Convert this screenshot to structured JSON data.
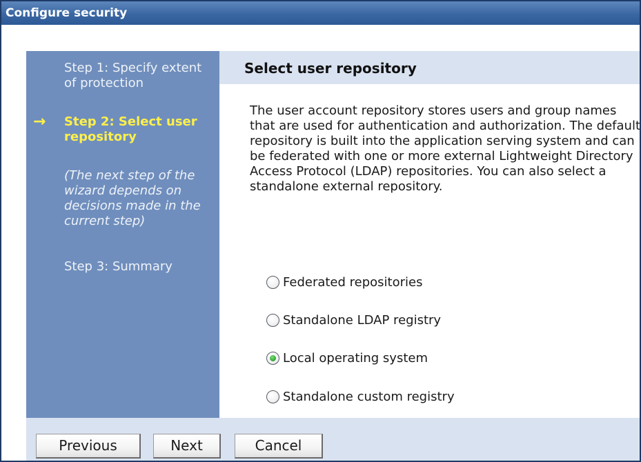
{
  "window": {
    "title": "Configure security"
  },
  "nav": {
    "step1": "Step 1: Specify extent of protection",
    "step2": "Step 2: Select user repository",
    "current_marker": "→",
    "note": "(The next step of the wizard depends on decisions made in the current step)",
    "step3": "Step 3: Summary"
  },
  "content": {
    "title": "Select user repository",
    "description": "The user account repository stores users and group names that are used for authentication and authorization. The default repository is built into the application serving system and can be federated with one or more external Lightweight Directory Access Protocol (LDAP) repositories. You can also select a standalone external repository.",
    "options": [
      {
        "label": "Federated repositories",
        "selected": false
      },
      {
        "label": "Standalone LDAP registry",
        "selected": false
      },
      {
        "label": "Local operating system",
        "selected": true
      },
      {
        "label": "Standalone custom registry",
        "selected": false
      }
    ]
  },
  "buttons": {
    "previous": "Previous",
    "next": "Next",
    "cancel": "Cancel"
  },
  "colors": {
    "titlebar": "#3a66a2",
    "nav_bg": "#6f8ebd",
    "current_step": "#fff04a",
    "header_bg": "#d9e2f0"
  }
}
